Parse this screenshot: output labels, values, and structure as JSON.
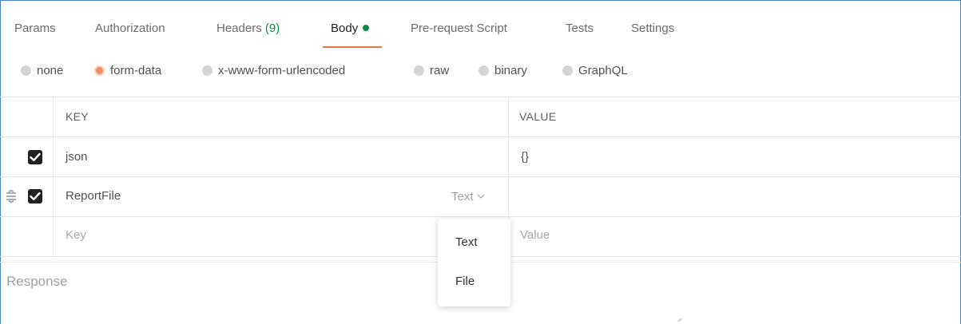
{
  "tabs": [
    {
      "label": "Params"
    },
    {
      "label": "Authorization"
    },
    {
      "label": "Headers",
      "count": "(9)"
    },
    {
      "label": "Body",
      "active": true
    },
    {
      "label": "Pre-request Script"
    },
    {
      "label": "Tests"
    },
    {
      "label": "Settings"
    }
  ],
  "body_types": [
    {
      "label": "none"
    },
    {
      "label": "form-data",
      "selected": true
    },
    {
      "label": "x-www-form-urlencoded"
    },
    {
      "label": "raw"
    },
    {
      "label": "binary"
    },
    {
      "label": "GraphQL"
    }
  ],
  "table": {
    "headers": {
      "key": "KEY",
      "value": "VALUE"
    },
    "rows": [
      {
        "checked": true,
        "key": "json",
        "value": "{}"
      },
      {
        "checked": true,
        "key": "ReportFile",
        "type": "Text",
        "value": ""
      }
    ],
    "placeholders": {
      "key": "Key",
      "value": "Value"
    }
  },
  "type_dropdown": {
    "options": [
      "Text",
      "File"
    ]
  },
  "response": {
    "label": "Response"
  },
  "colors": {
    "accent": "#e8764b",
    "active_dot": "#0f8a3c",
    "frame": "#4a86c5"
  }
}
